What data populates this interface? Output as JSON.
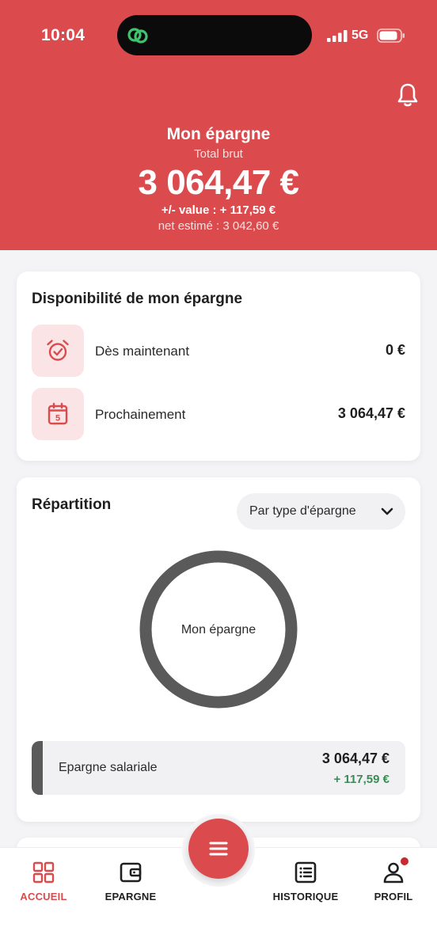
{
  "status_bar": {
    "time": "10:04",
    "network": "5G",
    "icons": [
      "link-icon",
      "signal-icon",
      "battery-icon"
    ]
  },
  "header": {
    "title": "Mon épargne",
    "subtitle": "Total brut",
    "total": "3 064,47 €",
    "plus_minus": "+/- value : + 117,59 €",
    "net": "net estimé : 3 042,60 €",
    "icon": "bell-icon"
  },
  "disponibilite": {
    "title": "Disponibilité de mon épargne",
    "rows": [
      {
        "icon": "alarm-clock-icon",
        "label": "Dès maintenant",
        "value": "0 €"
      },
      {
        "icon": "calendar-icon",
        "label": "Prochainement",
        "value": "3 064,47 €",
        "calendar_day": "5"
      }
    ]
  },
  "repartition": {
    "title": "Répartition",
    "select": {
      "selected": "Par type d'épargne",
      "icon": "chevron-down-icon"
    },
    "donut_center": "Mon épargne",
    "items": [
      {
        "name": "Epargne salariale",
        "amount": "3 064,47 €",
        "delta": "+ 117,59 €",
        "share": 1.0
      }
    ]
  },
  "bottom_nav": {
    "items": [
      {
        "label": "ACCUEIL",
        "icon": "grid-icon",
        "active": true
      },
      {
        "label": "EPARGNE",
        "icon": "wallet-icon",
        "active": false
      },
      {
        "label": "HISTORIQUE",
        "icon": "list-icon",
        "active": false
      },
      {
        "label": "PROFIL",
        "icon": "user-icon",
        "active": false,
        "has_notification": true
      }
    ],
    "fab_icon": "menu-icon"
  },
  "colors": {
    "brand": "#db4b4d",
    "icon_bg": "#fbe4e5",
    "donut": "#5a5a5a",
    "positive": "#3c8b57",
    "dynamic_island": "#0b0b0b",
    "link_icon": "#3ec46d"
  }
}
